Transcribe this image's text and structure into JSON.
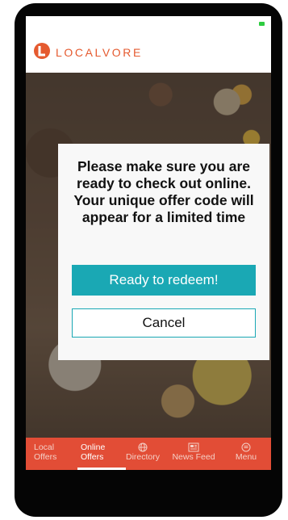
{
  "app": {
    "logo_text": "LOCALVORE",
    "brand_color": "#e55a2f"
  },
  "dialog": {
    "message": "Please make sure you are ready to check out online. Your unique offer code will appear for a limited time",
    "primary_button": "Ready to redeem!",
    "secondary_button": "Cancel",
    "accent_color": "#1aa8b4"
  },
  "tab_bar": {
    "color": "#e24d36",
    "tabs": [
      {
        "label_line1": "Local",
        "label_line2": "Offers",
        "icon": "none"
      },
      {
        "label_line1": "Online",
        "label_line2": "Offers",
        "icon": "none",
        "active": true
      },
      {
        "label": "Directory",
        "icon": "globe-icon"
      },
      {
        "label": "News Feed",
        "icon": "newspaper-icon"
      },
      {
        "label": "Menu",
        "icon": "menu-icon"
      }
    ]
  }
}
